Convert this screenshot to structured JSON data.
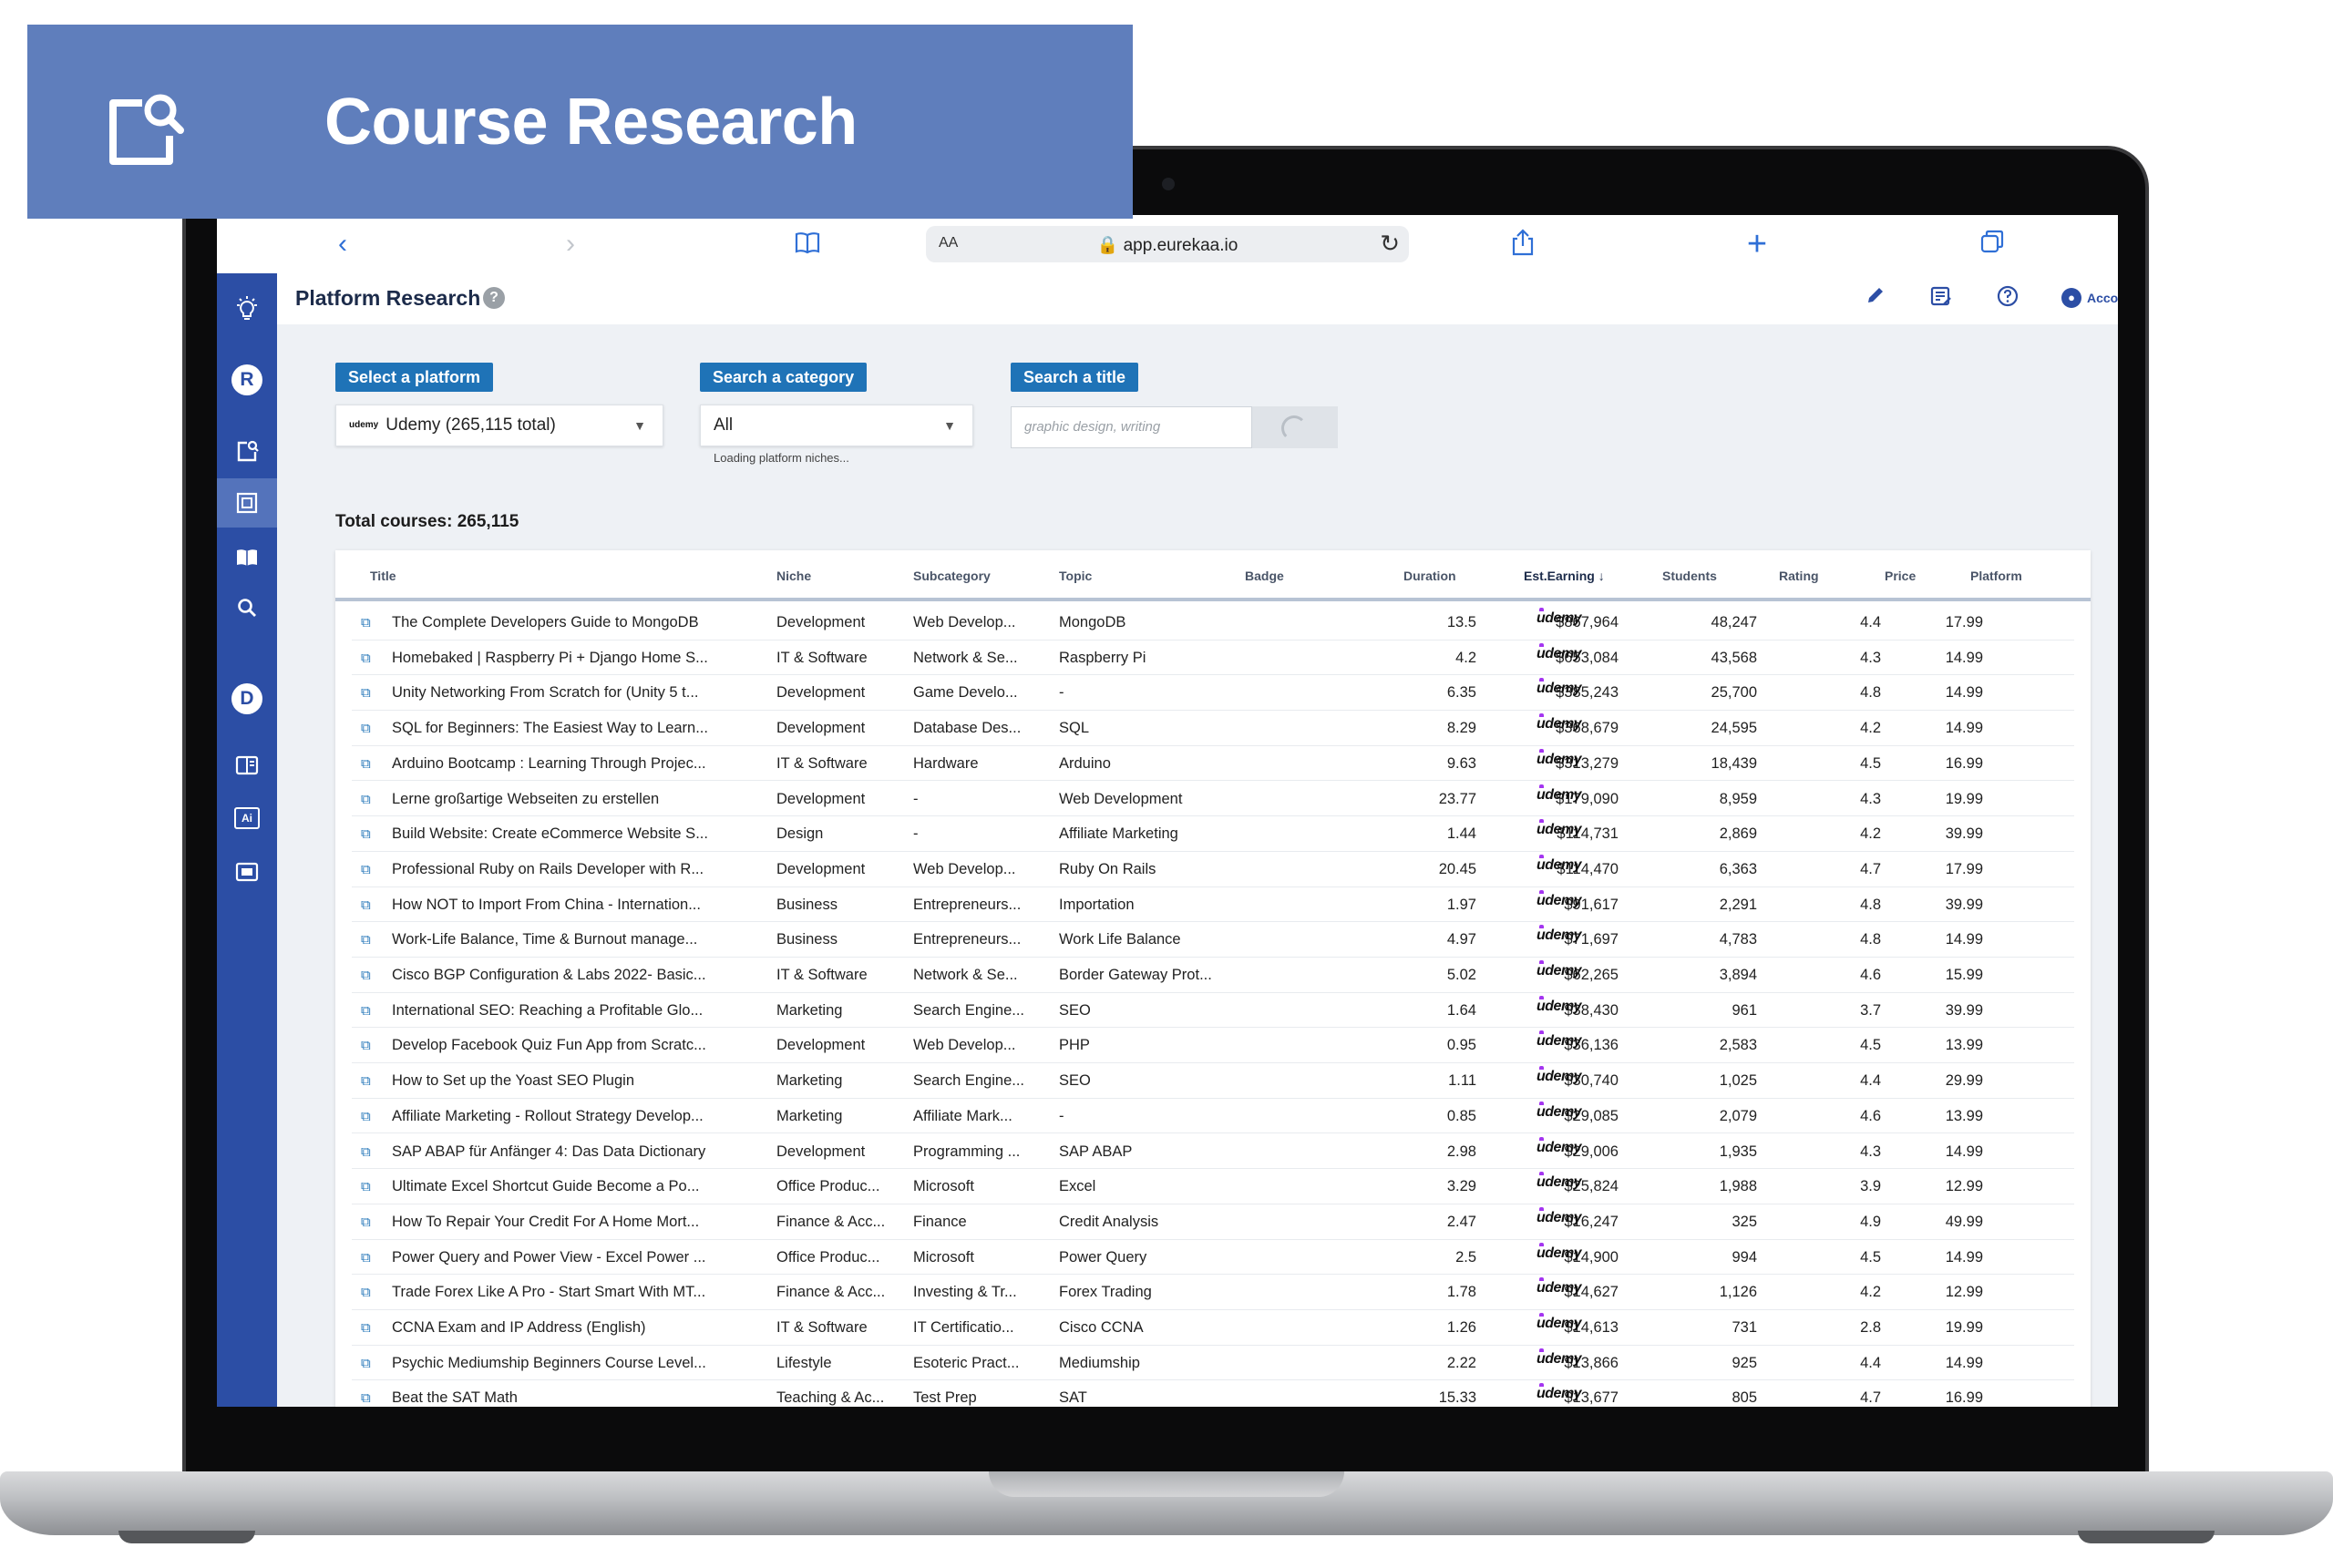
{
  "banner": {
    "title": "Course Research"
  },
  "browser": {
    "aa": "AA",
    "url": "app.eurekaa.io"
  },
  "sidebar": {
    "letters": [
      "R",
      "D"
    ],
    "ai_label": "Ai"
  },
  "header": {
    "title": "Platform Research",
    "help": "?",
    "account": "Account"
  },
  "filters": {
    "platform_label": "Select a platform",
    "platform_value": "Udemy (265,115 total)",
    "platform_logo": "udemy",
    "category_label": "Search a category",
    "category_value": "All",
    "category_hint": "Loading platform niches...",
    "title_label": "Search a title",
    "title_placeholder": "graphic design, writing"
  },
  "summary": {
    "total": "Total courses: 265,115"
  },
  "table": {
    "columns": [
      "Title",
      "Niche",
      "Subcategory",
      "Topic",
      "Badge",
      "Duration",
      "Est.Earning",
      "Students",
      "Rating",
      "Price",
      "Platform"
    ],
    "sort_indicator": "↓",
    "platform_logo": "udemy",
    "rows": [
      [
        "The Complete Developers Guide to MongoDB",
        "Development",
        "Web Develop...",
        "MongoDB",
        "",
        "13.5",
        "$867,964",
        "48,247",
        "4.4",
        "17.99"
      ],
      [
        "Homebaked | Raspberry Pi + Django Home S...",
        "IT & Software",
        "Network & Se...",
        "Raspberry Pi",
        "",
        "4.2",
        "$653,084",
        "43,568",
        "4.3",
        "14.99"
      ],
      [
        "Unity Networking From Scratch for (Unity 5 t...",
        "Development",
        "Game Develo...",
        "-",
        "",
        "6.35",
        "$385,243",
        "25,700",
        "4.8",
        "14.99"
      ],
      [
        "SQL for Beginners: The Easiest Way to Learn...",
        "Development",
        "Database Des...",
        "SQL",
        "",
        "8.29",
        "$368,679",
        "24,595",
        "4.2",
        "14.99"
      ],
      [
        "Arduino Bootcamp : Learning Through Projec...",
        "IT & Software",
        "Hardware",
        "Arduino",
        "",
        "9.63",
        "$313,279",
        "18,439",
        "4.5",
        "16.99"
      ],
      [
        "Lerne großartige Webseiten zu erstellen",
        "Development",
        "-",
        "Web Development",
        "",
        "23.77",
        "$179,090",
        "8,959",
        "4.3",
        "19.99"
      ],
      [
        "Build Website: Create eCommerce Website S...",
        "Design",
        "-",
        "Affiliate Marketing",
        "",
        "1.44",
        "$114,731",
        "2,869",
        "4.2",
        "39.99"
      ],
      [
        "Professional Ruby on Rails Developer with R...",
        "Development",
        "Web Develop...",
        "Ruby On Rails",
        "",
        "20.45",
        "$114,470",
        "6,363",
        "4.7",
        "17.99"
      ],
      [
        "How NOT to Import From China - Internation...",
        "Business",
        "Entrepreneurs...",
        "Importation",
        "",
        "1.97",
        "$91,617",
        "2,291",
        "4.8",
        "39.99"
      ],
      [
        "Work-Life Balance, Time & Burnout manage...",
        "Business",
        "Entrepreneurs...",
        "Work Life Balance",
        "",
        "4.97",
        "$71,697",
        "4,783",
        "4.8",
        "14.99"
      ],
      [
        "Cisco BGP Configuration & Labs 2022- Basic...",
        "IT & Software",
        "Network & Se...",
        "Border Gateway Prot...",
        "",
        "5.02",
        "$62,265",
        "3,894",
        "4.6",
        "15.99"
      ],
      [
        "International SEO: Reaching a Profitable Glo...",
        "Marketing",
        "Search Engine...",
        "SEO",
        "",
        "1.64",
        "$38,430",
        "961",
        "3.7",
        "39.99"
      ],
      [
        "Develop Facebook Quiz Fun App from Scratc...",
        "Development",
        "Web Develop...",
        "PHP",
        "",
        "0.95",
        "$36,136",
        "2,583",
        "4.5",
        "13.99"
      ],
      [
        "How to Set up the Yoast SEO Plugin",
        "Marketing",
        "Search Engine...",
        "SEO",
        "",
        "1.11",
        "$30,740",
        "1,025",
        "4.4",
        "29.99"
      ],
      [
        "Affiliate Marketing - Rollout Strategy Develop...",
        "Marketing",
        "Affiliate Mark...",
        "-",
        "",
        "0.85",
        "$29,085",
        "2,079",
        "4.6",
        "13.99"
      ],
      [
        "SAP ABAP für Anfänger 4: Das Data Dictionary",
        "Development",
        "Programming ...",
        "SAP ABAP",
        "",
        "2.98",
        "$29,006",
        "1,935",
        "4.3",
        "14.99"
      ],
      [
        "Ultimate Excel Shortcut Guide Become a Po...",
        "Office Produc...",
        "Microsoft",
        "Excel",
        "",
        "3.29",
        "$25,824",
        "1,988",
        "3.9",
        "12.99"
      ],
      [
        "How To Repair Your Credit For A Home Mort...",
        "Finance & Acc...",
        "Finance",
        "Credit Analysis",
        "",
        "2.47",
        "$16,247",
        "325",
        "4.9",
        "49.99"
      ],
      [
        "Power Query and Power View - Excel Power ...",
        "Office Produc...",
        "Microsoft",
        "Power Query",
        "",
        "2.5",
        "$14,900",
        "994",
        "4.5",
        "14.99"
      ],
      [
        "Trade Forex Like A Pro - Start Smart With MT...",
        "Finance & Acc...",
        "Investing & Tr...",
        "Forex Trading",
        "",
        "1.78",
        "$14,627",
        "1,126",
        "4.2",
        "12.99"
      ],
      [
        "CCNA Exam and IP Address (English)",
        "IT & Software",
        "IT Certificatio...",
        "Cisco CCNA",
        "",
        "1.26",
        "$14,613",
        "731",
        "2.8",
        "19.99"
      ],
      [
        "Psychic Mediumship Beginners Course Level...",
        "Lifestyle",
        "Esoteric Pract...",
        "Mediumship",
        "",
        "2.22",
        "$13,866",
        "925",
        "4.4",
        "14.99"
      ],
      [
        "Beat the SAT Math",
        "Teaching & Ac...",
        "Test Prep",
        "SAT",
        "",
        "15.33",
        "$13,677",
        "805",
        "4.7",
        "16.99"
      ]
    ]
  }
}
